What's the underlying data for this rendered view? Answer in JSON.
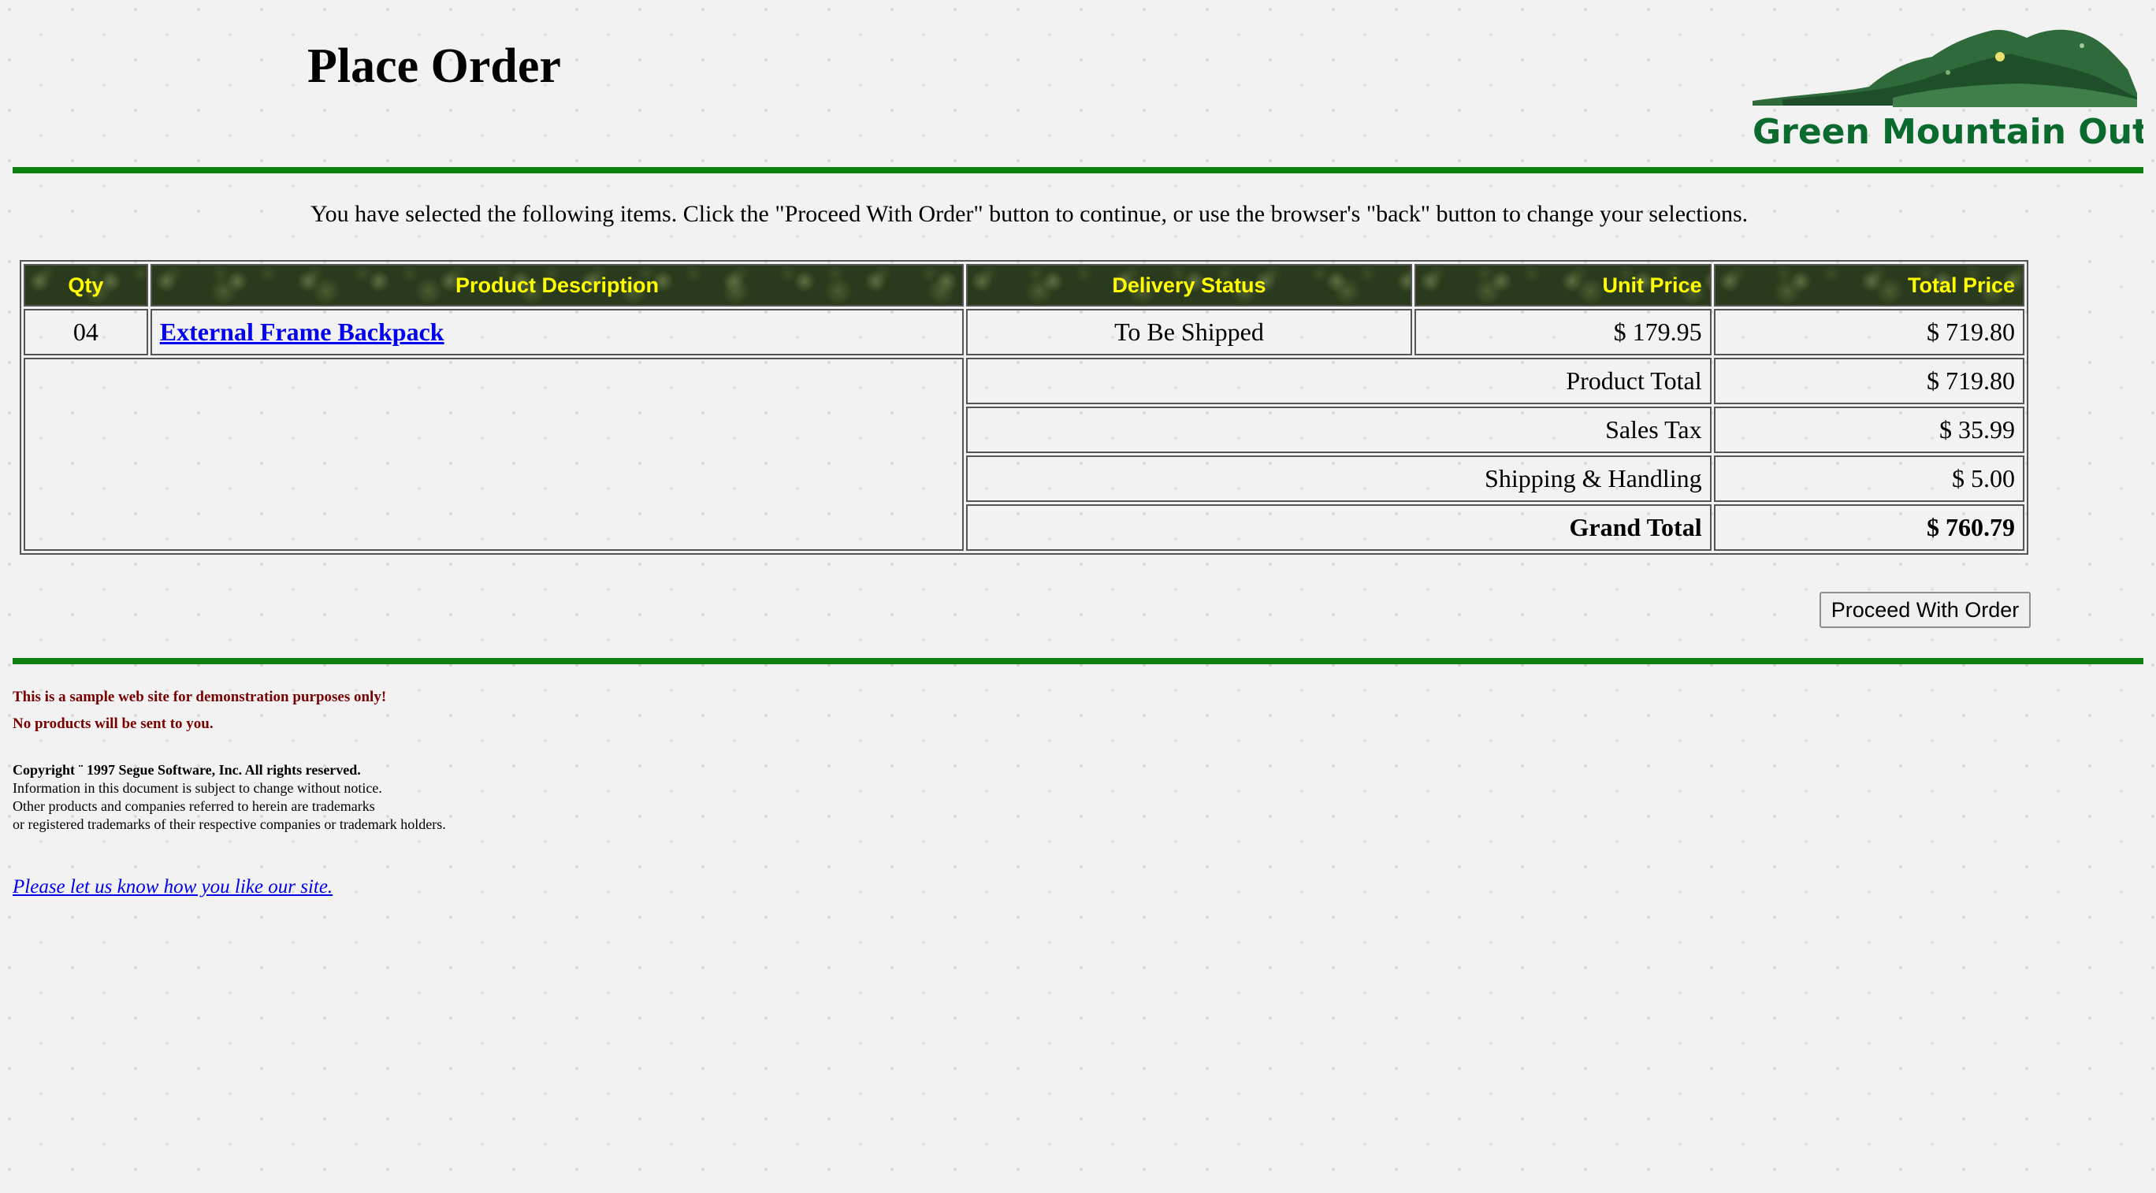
{
  "header": {
    "title": "Place Order",
    "logo_text": "Green Mountain Outpost"
  },
  "instruction": "You have selected the following items. Click the \"Proceed With Order\" button to continue, or use the browser's \"back\" button to change your selections.",
  "table": {
    "columns": [
      "Qty",
      "Product Description",
      "Delivery Status",
      "Unit Price",
      "Total Price"
    ],
    "items": [
      {
        "qty": "04",
        "description": "External Frame Backpack",
        "delivery_status": "To Be Shipped",
        "unit_price": "$ 179.95",
        "total_price": "$ 719.80"
      }
    ],
    "summary": [
      {
        "label": "Product Total",
        "value": "$ 719.80"
      },
      {
        "label": "Sales Tax",
        "value": "$ 35.99"
      },
      {
        "label": "Shipping & Handling",
        "value": "$ 5.00"
      },
      {
        "label": "Grand Total",
        "value": "$ 760.79"
      }
    ]
  },
  "actions": {
    "proceed_label": "Proceed With Order"
  },
  "footer": {
    "disclaimer_1": "This is a sample web site for demonstration purposes only!",
    "disclaimer_2": "No products will be sent to you.",
    "copyright": "Copyright ¨ 1997 Segue Software, Inc. All rights reserved.",
    "legal_lines": [
      "Information in this document is subject to change without notice.",
      "Other products and companies referred to herein are trademarks",
      "or registered trademarks of their respective companies or trademark holders."
    ],
    "feedback_link": "Please let us know how you like our site."
  },
  "colors": {
    "rule_green": "#0f7f0f",
    "header_text_yellow": "#ffff00",
    "link_blue": "#0000ee",
    "disclaimer_red": "#7a0000",
    "logo_green": "#0b6b2e"
  }
}
